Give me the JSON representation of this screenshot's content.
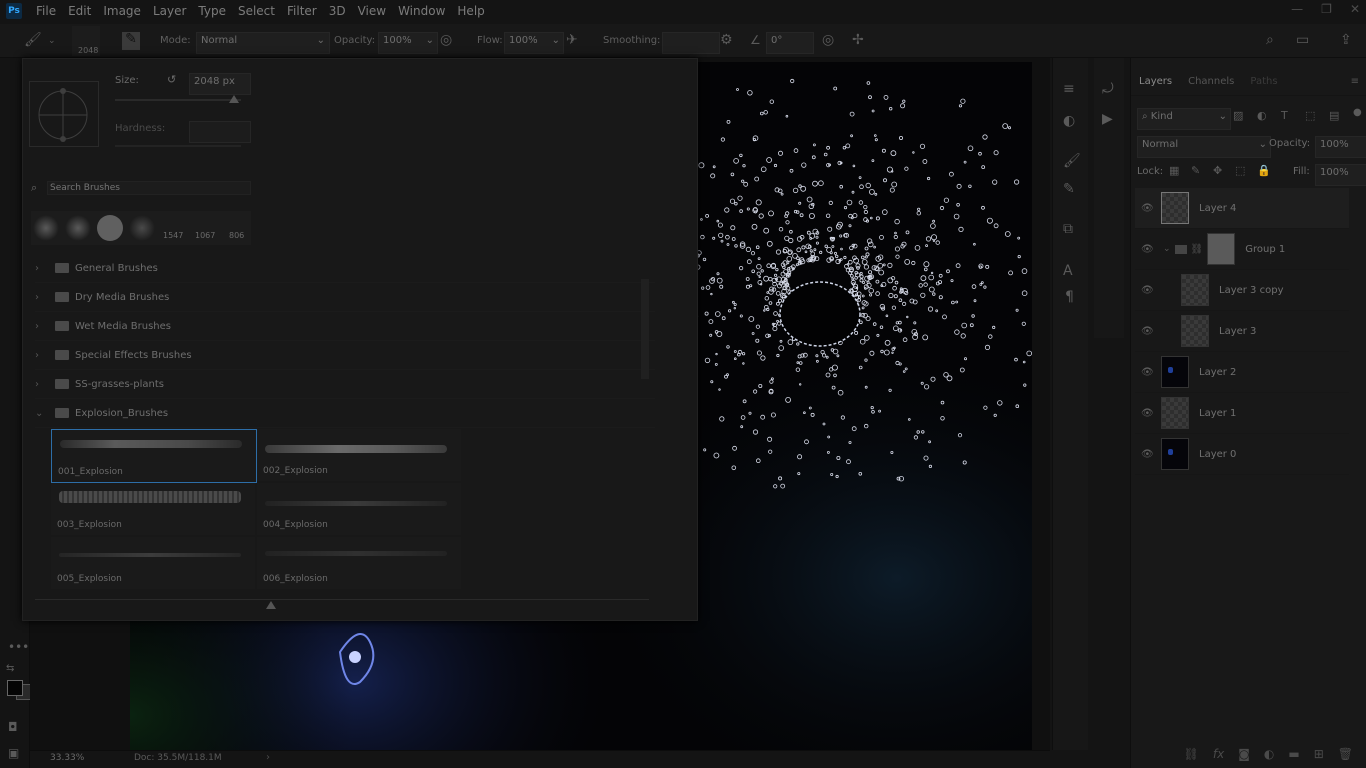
{
  "app": {
    "logo": "Ps"
  },
  "menu": [
    "File",
    "Edit",
    "Image",
    "Layer",
    "Type",
    "Select",
    "Filter",
    "3D",
    "View",
    "Window",
    "Help"
  ],
  "window_controls": [
    "—",
    "❐",
    "✕"
  ],
  "options": {
    "brush_size_value": "2048",
    "mode_label": "Mode:",
    "mode_value": "Normal",
    "opacity_label": "Opacity:",
    "opacity_value": "100%",
    "flow_label": "Flow:",
    "flow_value": "100%",
    "smoothing_label": "Smoothing:",
    "angle_value": "0°"
  },
  "brush_panel": {
    "size_label": "Size:",
    "size_value": "2048 px",
    "hardness_label": "Hardness:",
    "search_placeholder": "Search Brushes",
    "recent_sizes": [
      "1547",
      "1067",
      "806"
    ],
    "folders": [
      {
        "name": "General Brushes",
        "expanded": false
      },
      {
        "name": "Dry Media Brushes",
        "expanded": false
      },
      {
        "name": "Wet Media Brushes",
        "expanded": false
      },
      {
        "name": "Special Effects Brushes",
        "expanded": false
      },
      {
        "name": "SS-grasses-plants",
        "expanded": false
      },
      {
        "name": "Explosion_Brushes",
        "expanded": true
      }
    ],
    "brushes": [
      "001_Explosion",
      "002_Explosion",
      "003_Explosion",
      "004_Explosion",
      "005_Explosion",
      "006_Explosion"
    ],
    "selected_brush": "001_Explosion"
  },
  "layers_panel": {
    "tabs": [
      "Layers",
      "Channels",
      "Paths"
    ],
    "filter_kind": "Kind",
    "blend_mode": "Normal",
    "opacity_label": "Opacity:",
    "opacity_value": "100%",
    "lock_label": "Lock:",
    "fill_label": "Fill:",
    "fill_value": "100%",
    "layers": [
      {
        "name": "Layer 4",
        "thumb": "checker",
        "selected": true,
        "indent": 0
      },
      {
        "name": "Group 1",
        "thumb": "group",
        "selected": false,
        "indent": 0
      },
      {
        "name": "Layer 3 copy",
        "thumb": "checker",
        "selected": false,
        "indent": 1
      },
      {
        "name": "Layer 3",
        "thumb": "checker",
        "selected": false,
        "indent": 1
      },
      {
        "name": "Layer 2",
        "thumb": "dark",
        "selected": false,
        "indent": 0
      },
      {
        "name": "Layer 1",
        "thumb": "checker",
        "selected": false,
        "indent": 0
      },
      {
        "name": "Layer 0",
        "thumb": "dark",
        "selected": false,
        "indent": 0
      }
    ]
  },
  "status": {
    "zoom": "33.33%",
    "doc": "Doc: 35.5M/118.1M"
  },
  "colors": {
    "accent_selection": "#2d6ea8",
    "ps_blue": "#31a8ff",
    "panel_bg": "#181818"
  }
}
